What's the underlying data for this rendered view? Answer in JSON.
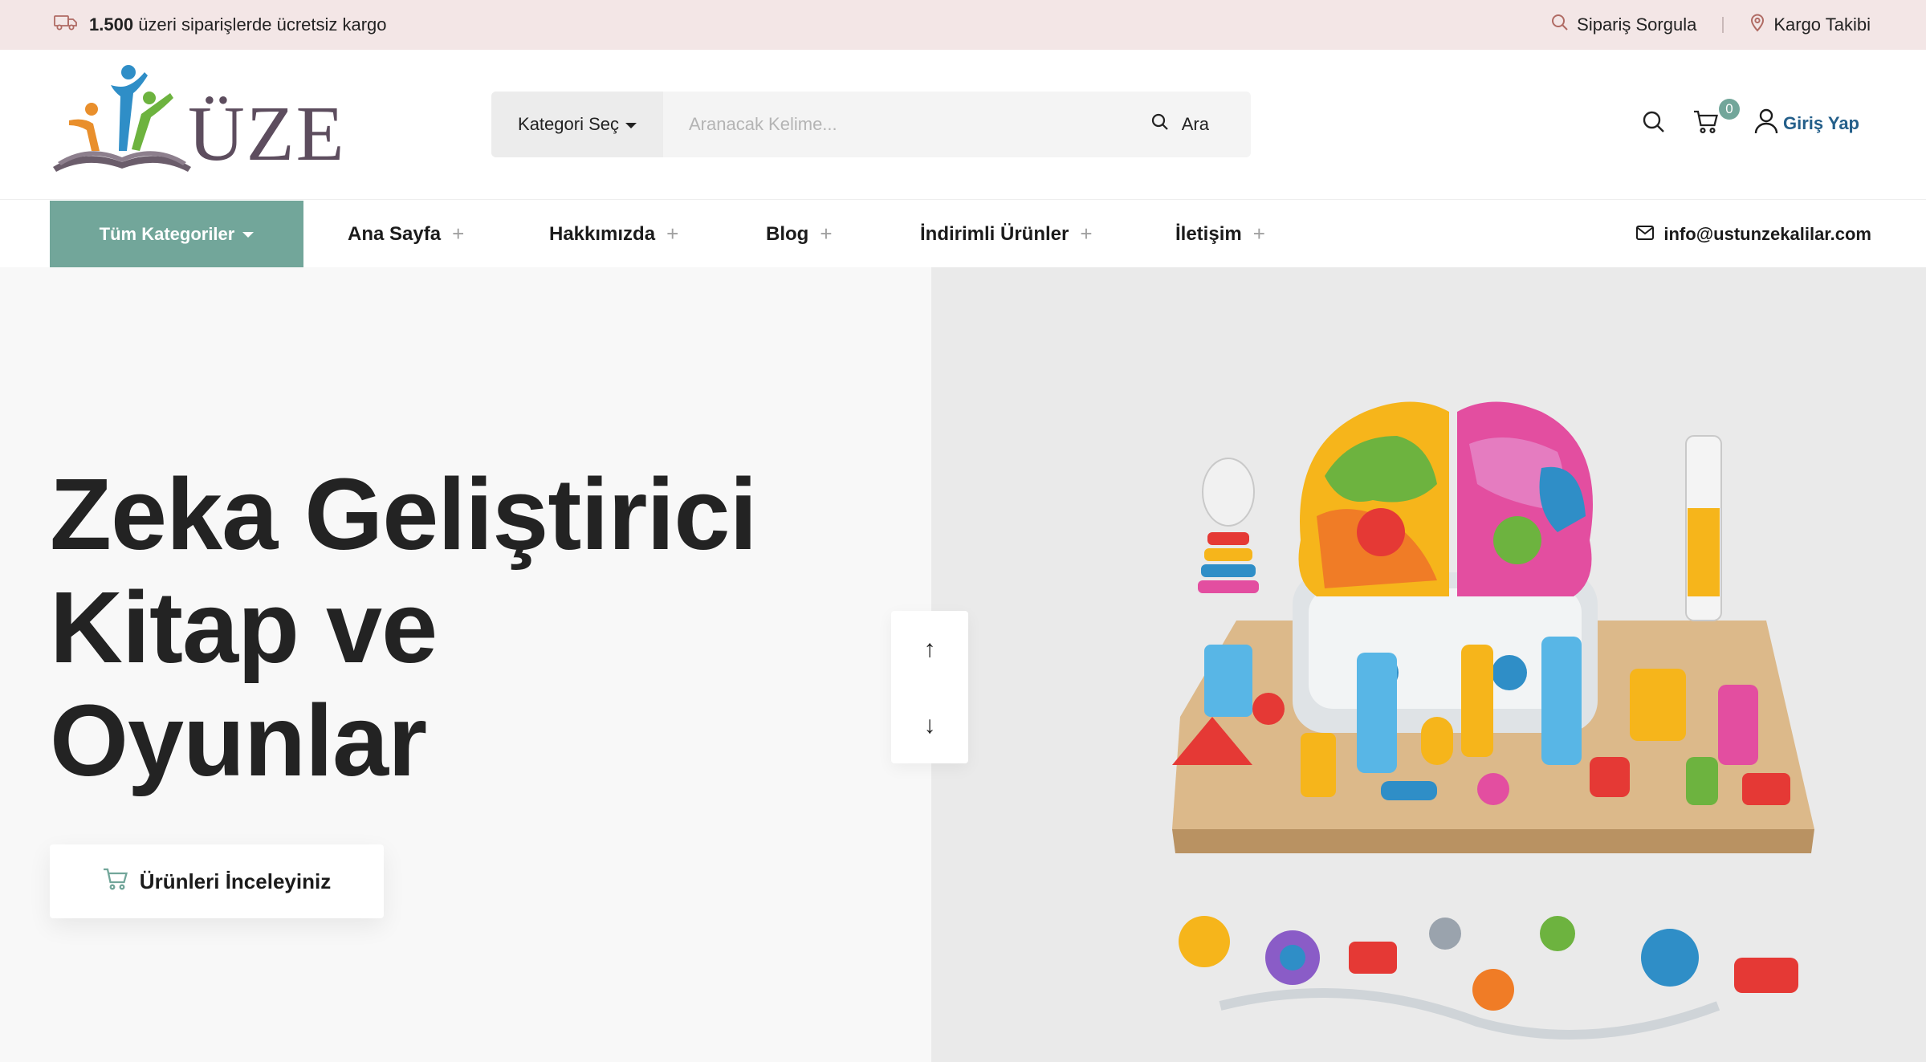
{
  "topbar": {
    "promo_bold": "1.500",
    "promo_text": "üzeri siparişlerde ücretsiz kargo",
    "order_query": "Sipariş Sorgula",
    "cargo_tracking": "Kargo Takibi"
  },
  "header": {
    "logo_text": "ÜZE",
    "search": {
      "category_label": "Kategori Seç",
      "placeholder": "Aranacak Kelime...",
      "button_label": "Ara"
    },
    "cart_count": "0",
    "login_label": "Giriş Yap"
  },
  "nav": {
    "all_categories": "Tüm Kategoriler",
    "items": [
      {
        "label": "Ana Sayfa"
      },
      {
        "label": "Hakkımızda"
      },
      {
        "label": "Blog"
      },
      {
        "label": "İndirimli Ürünler"
      },
      {
        "label": "İletişim"
      }
    ],
    "email": "info@ustunzekalilar.com"
  },
  "hero": {
    "title_lines": [
      "Zeka Geliştirici",
      "Kitap ve",
      "Oyunlar"
    ],
    "cta_label": "Ürünleri İnceleyiniz",
    "prev_arrow": "↑",
    "next_arrow": "↓"
  },
  "colors": {
    "accent": "#72a69a",
    "topbar_bg": "#f3e6e6",
    "login_text": "#245f8a",
    "logo_text": "#5d4d5e"
  },
  "icons": {
    "promo": "truck-icon",
    "order_query": "search-icon",
    "cargo_tracking": "map-pin-icon",
    "header_search": "search-icon",
    "cart": "cart-icon",
    "login": "user-icon",
    "email": "mail-icon",
    "cta": "cart-icon"
  }
}
